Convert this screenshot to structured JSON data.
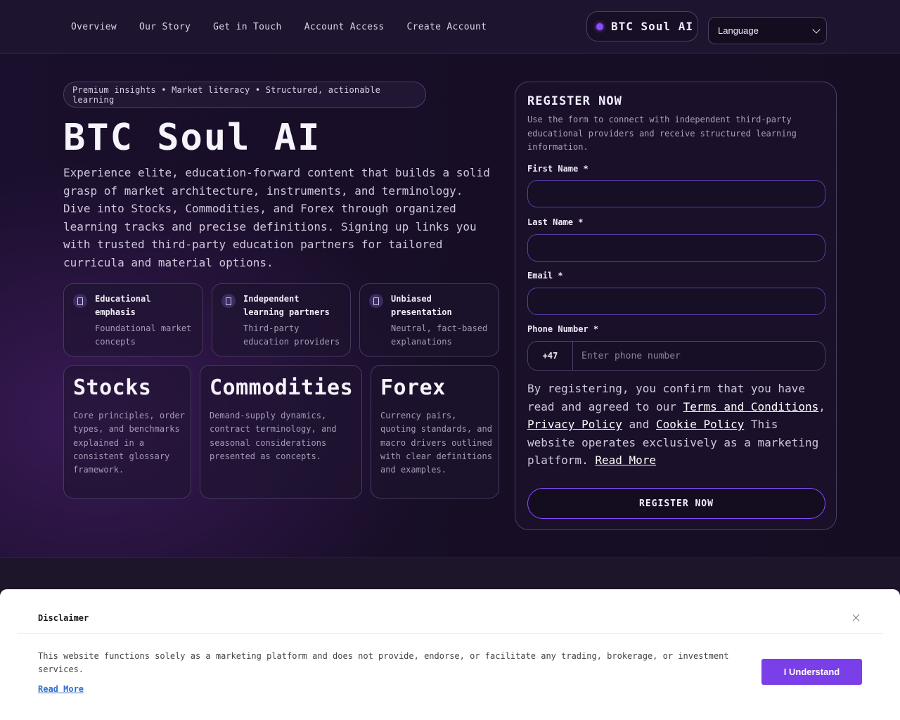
{
  "nav": {
    "links": [
      "Overview",
      "Our Story",
      "Get in Touch",
      "Account Access",
      "Create Account"
    ],
    "brand": "BTC Soul AI",
    "language": "Language"
  },
  "hero": {
    "tagline": "Premium insights • Market literacy • Structured, actionable learning",
    "title": "BTC Soul AI",
    "description": "Experience elite, education-forward content that builds a solid grasp of market architecture, instruments, and terminology. Dive into Stocks, Commodities, and Forex through organized learning tracks and precise definitions. Signing up links you with trusted third-party education partners for tailored curricula and material options.",
    "features": [
      {
        "title": "Educational emphasis",
        "subtitle": "Foundational market concepts"
      },
      {
        "title": "Independent learning partners",
        "subtitle": "Third-party education providers"
      },
      {
        "title": "Unbiased presentation",
        "subtitle": "Neutral, fact-based explanations"
      }
    ],
    "markets": [
      {
        "title": "Stocks",
        "description": "Core principles, order types, and benchmarks explained in a consistent glossary framework."
      },
      {
        "title": "Commodities",
        "description": "Demand-supply dynamics, contract terminology, and seasonal considerations presented as concepts."
      },
      {
        "title": "Forex",
        "description": "Currency pairs, quoting standards, and macro drivers outlined with clear definitions and examples."
      }
    ]
  },
  "form": {
    "title": "REGISTER NOW",
    "subtitle": "Use the form to connect with independent third-party educational providers and receive structured learning information.",
    "first_name_label": "First Name *",
    "last_name_label": "Last Name *",
    "email_label": "Email *",
    "phone_label": "Phone Number *",
    "phone_code": "+47",
    "phone_placeholder": "Enter phone number",
    "consent_prefix": "By registering, you confirm that you have read and agreed to our ",
    "terms_link": "Terms and Conditions",
    "comma": ",",
    "privacy_link": "Privacy Policy",
    "and": " and ",
    "cookie_link": "Cookie Policy",
    "consent_suffix": " This website operates exclusively as a marketing platform. ",
    "read_more": "Read More",
    "submit": "REGISTER NOW"
  },
  "disclaimer": {
    "title": "Disclaimer",
    "text": "This website functions solely as a marketing platform and does not provide, endorse, or facilitate any trading, brokerage, or investment services.",
    "read_more": "Read More",
    "button": "I Understand"
  },
  "colors": {
    "accent": "#8a4dff",
    "button": "#7a3fe8",
    "background": "#1b1029"
  }
}
